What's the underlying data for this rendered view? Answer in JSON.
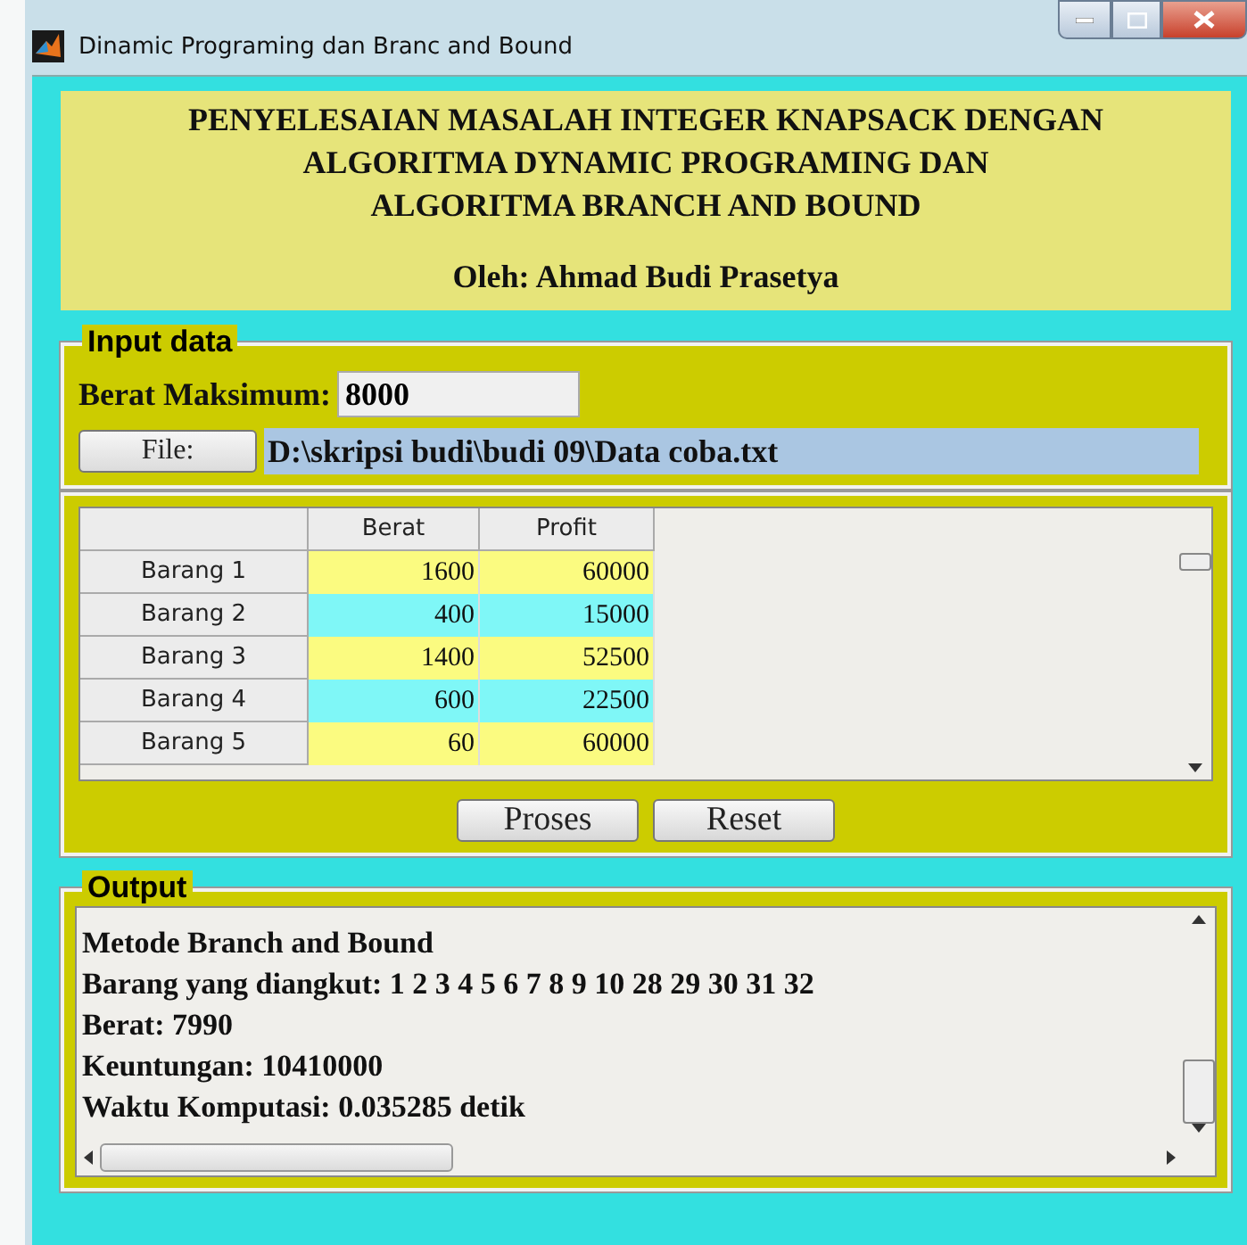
{
  "window": {
    "title": "Dinamic Programing dan Branc and Bound"
  },
  "header": {
    "title_lines": [
      "PENYELESAIAN MASALAH INTEGER KNAPSACK DENGAN",
      "ALGORITMA DYNAMIC PROGRAMING DAN",
      "ALGORITMA BRANCH AND BOUND"
    ],
    "author": "Oleh: Ahmad Budi Prasetya"
  },
  "input_panel": {
    "title": "Input data",
    "max_weight_label": "Berat Maksimum:",
    "max_weight_value": "8000",
    "file_button": "File:",
    "file_path": "D:\\skripsi budi\\budi 09\\Data coba.txt"
  },
  "table": {
    "columns": [
      "Berat",
      "Profit"
    ],
    "rows": [
      {
        "label": "Barang 1",
        "cells": [
          "1600",
          "60000"
        ]
      },
      {
        "label": "Barang 2",
        "cells": [
          "400",
          "15000"
        ]
      },
      {
        "label": "Barang 3",
        "cells": [
          "1400",
          "52500"
        ]
      },
      {
        "label": "Barang 4",
        "cells": [
          "600",
          "22500"
        ]
      },
      {
        "label": "Barang 5",
        "cells": [
          "60",
          "60000"
        ]
      }
    ]
  },
  "buttons": [
    "Proses",
    "Reset"
  ],
  "output_panel": {
    "title": "Output",
    "lines": [
      "Metode Branch and Bound",
      "Barang yang diangkut: 1 2 3 4 5 6 7 8 9 10 28 29 30 31 32",
      "Berat: 7990",
      "Keuntungan: 10410000",
      "Waktu Komputasi: 0.035285 detik"
    ]
  }
}
